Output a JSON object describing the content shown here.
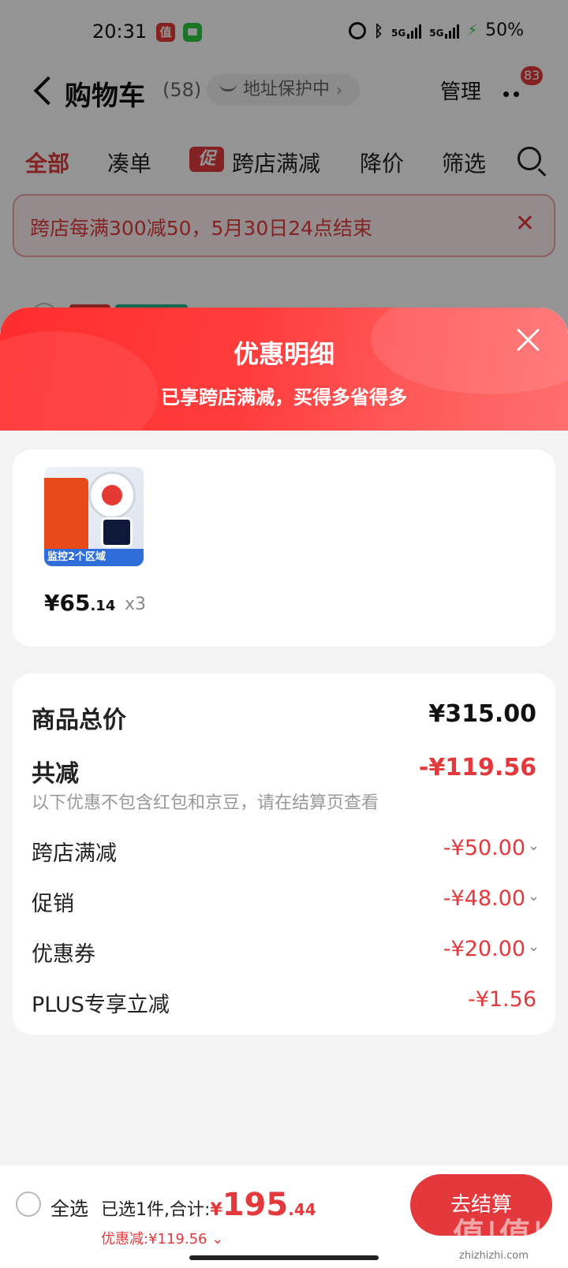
{
  "status_bar": {
    "time": "20:31",
    "app_icon_1": "值",
    "signal_1": "5G",
    "signal_2": "5G",
    "battery": "50%"
  },
  "header": {
    "title": "购物车",
    "count": "(58)",
    "address_pill": "地址保护中",
    "manage": "管理",
    "more_badge": "83"
  },
  "tabs": [
    {
      "label": "全部",
      "active": true
    },
    {
      "label": "凑单"
    },
    {
      "label": "跨店满减",
      "badge": "促"
    },
    {
      "label": "降价"
    },
    {
      "label": "筛选"
    }
  ],
  "promo_banner": {
    "text": "跨店每满300减50，5月30日24点结束",
    "close_icon": "close-icon"
  },
  "sheet": {
    "title": "优惠明细",
    "subtitle": "已享跨店满减，买得多省得多",
    "product": {
      "price_symbol": "¥",
      "price_int": "65",
      "price_dec": ".14",
      "quantity": "x3",
      "thumb_text": "监控2个区域"
    },
    "details": {
      "total_label": "商品总价",
      "total_value": "¥315.00",
      "reduce_label": "共减",
      "reduce_value": "-¥119.56",
      "reduce_note": "以下优惠不包含红包和京豆，请在结算页查看",
      "items": [
        {
          "label": "跨店满减",
          "value": "-¥50.00"
        },
        {
          "label": "促销",
          "value": "-¥48.00"
        },
        {
          "label": "优惠券",
          "value": "-¥20.00"
        },
        {
          "label": "PLUS专享立减",
          "value": "-¥1.56"
        }
      ]
    }
  },
  "bottom_bar": {
    "select_all": "全选",
    "summary_prefix": "已选1件,合计:",
    "currency": "¥",
    "total_int": "195",
    "total_dec": ".44",
    "discount": "优惠减:¥119.56",
    "checkout": "去结算"
  },
  "watermark": {
    "text": "值|值|值",
    "url": "zhizhizhi.com"
  },
  "colors": {
    "accent": "#e4393c",
    "sheet_header": "#ff3333"
  }
}
